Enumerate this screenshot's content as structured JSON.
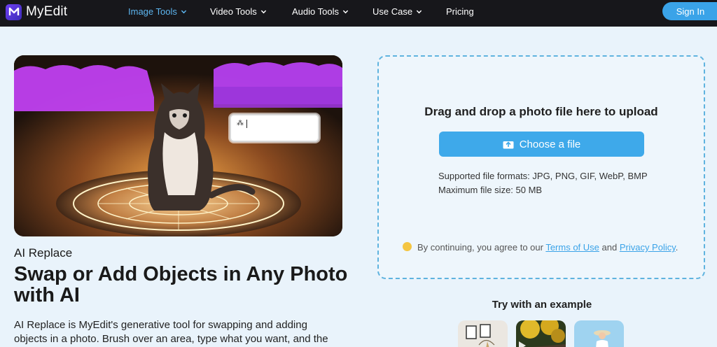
{
  "nav": {
    "brand": "MyEdit",
    "items": [
      {
        "label": "Image Tools",
        "active": true
      },
      {
        "label": "Video Tools",
        "active": false
      },
      {
        "label": "Audio Tools",
        "active": false
      },
      {
        "label": "Use Case",
        "active": false
      },
      {
        "label": "Pricing",
        "active": false
      }
    ],
    "signin_label": "Sign In"
  },
  "hero": {
    "eyebrow": "AI Replace",
    "title": "Swap or Add Objects in Any Photo with AI",
    "description": "AI Replace is MyEdit's generative tool for swapping and adding objects in a photo. Brush over an area, type what you want, and the"
  },
  "upload": {
    "title": "Drag and drop a photo file here to upload",
    "button_label": "Choose a file",
    "formats_line": "Supported file formats: JPG, PNG, GIF, WebP, BMP",
    "size_line": "Maximum file size: 50 MB",
    "consent_prefix": "By continuing, you agree to our ",
    "terms_label": "Terms of Use",
    "consent_and": " and ",
    "privacy_label": "Privacy Policy",
    "consent_suffix": "."
  },
  "examples": {
    "title": "Try with an example"
  },
  "colors": {
    "accent": "#3ea9ea",
    "nav_bg": "#17171b",
    "active_nav": "#5db6f0"
  }
}
